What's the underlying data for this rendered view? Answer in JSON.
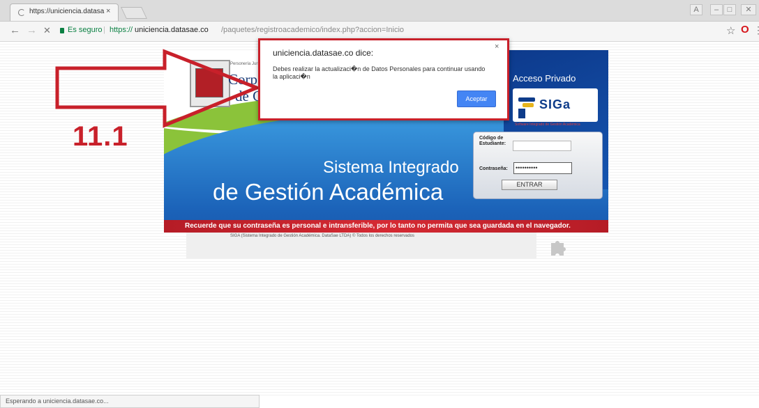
{
  "browser": {
    "tab_title": "https://uniciencia.datasa",
    "tab_close": "×",
    "window_controls": [
      "A",
      "–",
      "□",
      "✕"
    ],
    "secure_label": "Es seguro",
    "url_protocol": "https://",
    "url_host": "uniciencia.datasae.co",
    "url_path": "/paquetes/registroacademico/index.php?accion=Inicio",
    "nav_back": "←",
    "nav_forward": "→",
    "nav_stop": "✕",
    "star": "☆",
    "opera": "O",
    "menu": "⋮"
  },
  "banner": {
    "personeria": "Personería Jurídica",
    "corp_line1": "Corp",
    "corp_line2": "de C",
    "acceso_privado": "Acceso Privado",
    "siga_logo": "SIGa",
    "siga_sub": "Software Integrado de Gestión Académica",
    "sistema": "Sistema Integrado",
    "gestion": "de Gestión Académica",
    "login": {
      "codigo_label": "Código de Estudiante:",
      "codigo_value": "",
      "pass_label": "Contraseña:",
      "pass_value": "••••••••••",
      "entrar": "ENTRAR"
    },
    "warning": "Recuerde que su contraseña es personal e intransferible, por lo tanto no permita que sea guardada en el navegador."
  },
  "footer": {
    "copyright": "SIGA (Sistema Integrado de Gestión Académica. DataSae LTDA) © Todos los derechos reservados"
  },
  "annotation": {
    "step": "11.1"
  },
  "dialog": {
    "title": "uniciencia.datasae.co dice:",
    "close": "×",
    "message": "Debes realizar la actualizaci�n de Datos Personales para continuar usando la aplicaci�n",
    "ok": "Aceptar"
  },
  "status_bar": "Esperando a uniciencia.datasae.co..."
}
